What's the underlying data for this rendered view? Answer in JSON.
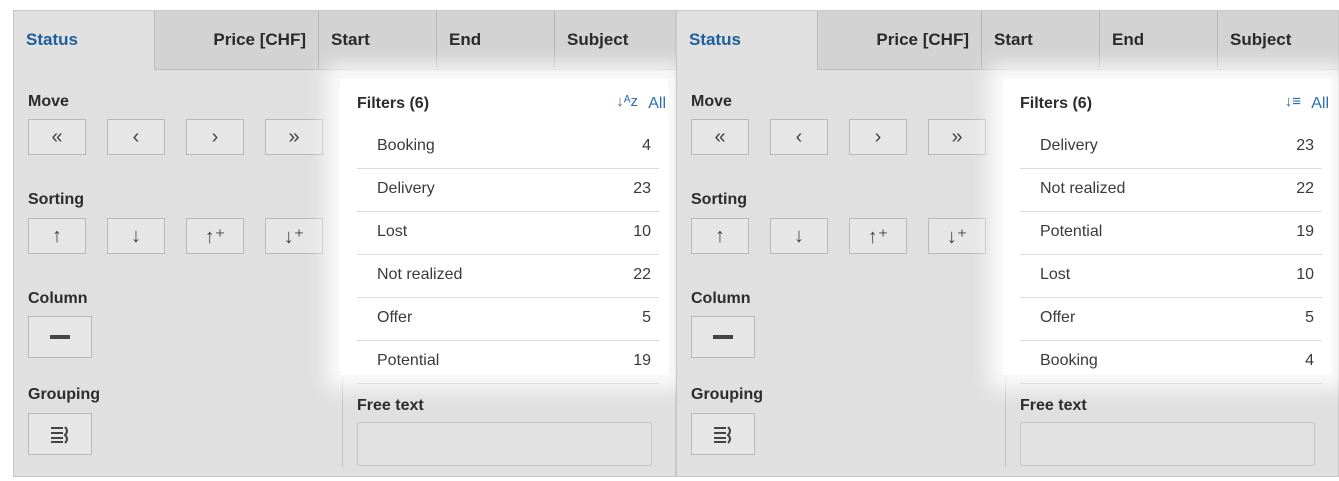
{
  "panels": [
    {
      "columns": [
        "Status",
        "Price [CHF]",
        "Start",
        "End",
        "Subject"
      ],
      "sections": {
        "move": "Move",
        "sorting": "Sorting",
        "column": "Column",
        "grouping": "Grouping"
      },
      "move_buttons": [
        "«",
        "‹",
        "›",
        "»"
      ],
      "sort_buttons": [
        "↑",
        "↓",
        "↑⁺",
        "↓⁺"
      ],
      "filters": {
        "title": "Filters (6)",
        "sort_icon": "sort-alpha-icon",
        "sort_glyph": "↓ᴬᴢ",
        "all": "All",
        "items": [
          {
            "name": "Booking",
            "count": "4"
          },
          {
            "name": "Delivery",
            "count": "23"
          },
          {
            "name": "Lost",
            "count": "10"
          },
          {
            "name": "Not realized",
            "count": "22"
          },
          {
            "name": "Offer",
            "count": "5"
          },
          {
            "name": "Potential",
            "count": "19"
          }
        ]
      },
      "free_text": "Free text"
    },
    {
      "columns": [
        "Status",
        "Price [CHF]",
        "Start",
        "End",
        "Subject"
      ],
      "sections": {
        "move": "Move",
        "sorting": "Sorting",
        "column": "Column",
        "grouping": "Grouping"
      },
      "move_buttons": [
        "«",
        "‹",
        "›",
        "»"
      ],
      "sort_buttons": [
        "↑",
        "↓",
        "↑⁺",
        "↓⁺"
      ],
      "filters": {
        "title": "Filters (6)",
        "sort_icon": "sort-count-icon",
        "sort_glyph": "↓≡",
        "all": "All",
        "items": [
          {
            "name": "Delivery",
            "count": "23"
          },
          {
            "name": "Not realized",
            "count": "22"
          },
          {
            "name": "Potential",
            "count": "19"
          },
          {
            "name": "Lost",
            "count": "10"
          },
          {
            "name": "Offer",
            "count": "5"
          },
          {
            "name": "Booking",
            "count": "4"
          }
        ]
      },
      "free_text": "Free text"
    }
  ]
}
